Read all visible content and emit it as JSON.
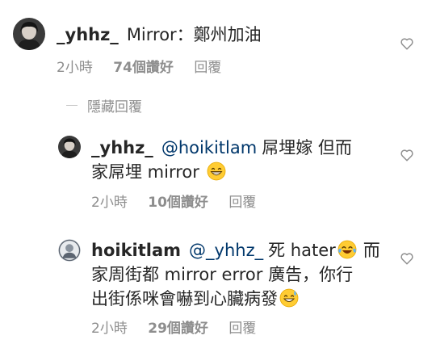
{
  "comments": [
    {
      "username": "_yhhz_",
      "mention": "",
      "text": "Mirror：鄭州加油",
      "time": "2小時",
      "likes": "74個讚好",
      "reply_label": "回覆",
      "avatar": "avatar-dark",
      "like_icon": "heart-outline-icon"
    },
    {
      "username": "_yhhz_",
      "mention": "@hoikitlam",
      "text_line1": "屌埋嫁 但而",
      "text_line2": "家屌埋 mirror",
      "emoji": "grinning-face-emoji",
      "time": "2小時",
      "likes": "10個讚好",
      "reply_label": "回覆",
      "avatar": "avatar-dark",
      "like_icon": "heart-outline-icon"
    },
    {
      "username": "hoikitlam",
      "mention": "@_yhhz_",
      "text_line1a": "死 hater",
      "emoji1": "tears-of-joy-emoji",
      "text_line1b": "而",
      "text_line2": "家周街都 mirror error 廣告，你行",
      "text_line3": "出街係咪會嚇到心臟病發",
      "emoji2": "sweat-smile-emoji",
      "time": "2小時",
      "likes": "29個讚好",
      "reply_label": "回覆",
      "avatar": "avatar-light",
      "like_icon": "heart-outline-icon"
    }
  ],
  "hide_replies_label": "隱藏回覆",
  "colors": {
    "text": "#262626",
    "meta": "#8e8e8e",
    "mention": "#00376b",
    "divider": "#c7c7c7"
  }
}
